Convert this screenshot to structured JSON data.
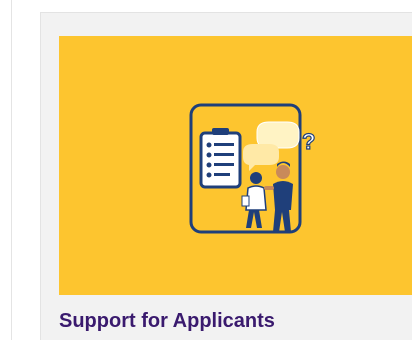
{
  "card": {
    "title": "Support for Applicants",
    "image_icon": "applicant-support-illustration-icon"
  },
  "colors": {
    "accent": "#fdc52f",
    "title": "#3a1a6e",
    "card_background": "#f2f2f2",
    "illustration_line": "#1f3f7a"
  }
}
